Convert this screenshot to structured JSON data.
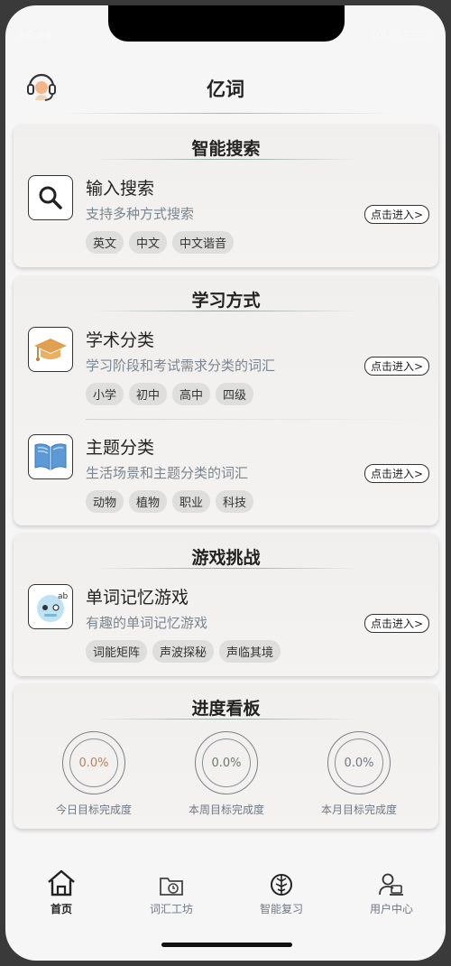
{
  "status": {
    "time": "14:44",
    "battery": "100%"
  },
  "header": {
    "title": "亿词"
  },
  "search_card": {
    "title": "智能搜索",
    "item": {
      "name": "输入搜索",
      "desc": "支持多种方式搜索",
      "button": "点击进入>",
      "tags": [
        "英文",
        "中文",
        "中文谐音"
      ]
    }
  },
  "study_card": {
    "title": "学习方式",
    "items": [
      {
        "name": "学术分类",
        "desc": "学习阶段和考试需求分类的词汇",
        "button": "点击进入>",
        "tags": [
          "小学",
          "初中",
          "高中",
          "四级"
        ]
      },
      {
        "name": "主题分类",
        "desc": "生活场景和主题分类的词汇",
        "button": "点击进入>",
        "tags": [
          "动物",
          "植物",
          "职业",
          "科技"
        ]
      }
    ]
  },
  "game_card": {
    "title": "游戏挑战",
    "item": {
      "name": "单词记忆游戏",
      "desc": "有趣的单词记忆游戏",
      "button": "点击进入>",
      "tags": [
        "词能矩阵",
        "声波探秘",
        "声临其境"
      ]
    }
  },
  "progress_card": {
    "title": "进度看板",
    "rings": [
      {
        "value": "0.0%",
        "label": "今日目标完成度",
        "color": "#b5835a"
      },
      {
        "value": "0.0%",
        "label": "本周目标完成度",
        "color": "#6b7a6a"
      },
      {
        "value": "0.0%",
        "label": "本月目标完成度",
        "color": "#6d7785"
      }
    ]
  },
  "tabbar": {
    "tabs": [
      {
        "label": "首页",
        "icon": "home-icon",
        "active": true
      },
      {
        "label": "词汇工坊",
        "icon": "folder-clock-icon",
        "active": false
      },
      {
        "label": "智能复习",
        "icon": "brain-icon",
        "active": false
      },
      {
        "label": "用户中心",
        "icon": "user-laptop-icon",
        "active": false
      }
    ]
  },
  "colors": {
    "accent": "#e0a050",
    "book": "#5b9ad6",
    "text": "#222222",
    "muted": "#7a8590"
  }
}
